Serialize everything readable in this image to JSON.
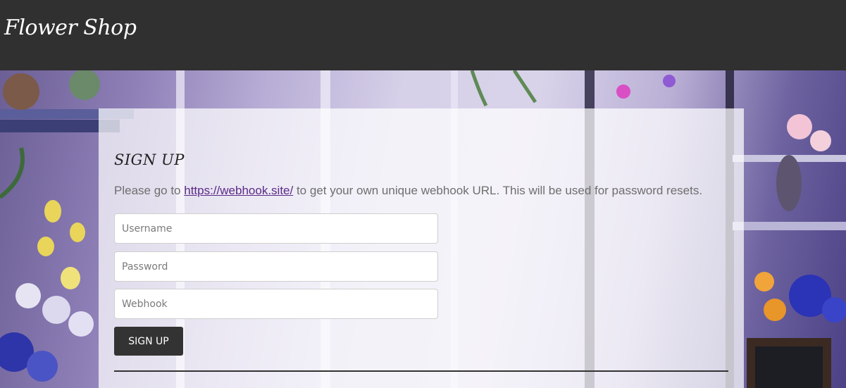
{
  "header": {
    "brand": "Flower Shop"
  },
  "signup": {
    "title": "SIGN UP",
    "instructions_prefix": "Please go to ",
    "link_text": "https://webhook.site/",
    "instructions_suffix": " to get your own unique webhook URL. This will be used for password resets.",
    "username_placeholder": "Username",
    "password_placeholder": "Password",
    "webhook_placeholder": "Webhook",
    "submit_label": "SIGN UP"
  },
  "colors": {
    "header_bg": "#303030",
    "button_bg": "#333333",
    "link": "#5b2a86"
  }
}
